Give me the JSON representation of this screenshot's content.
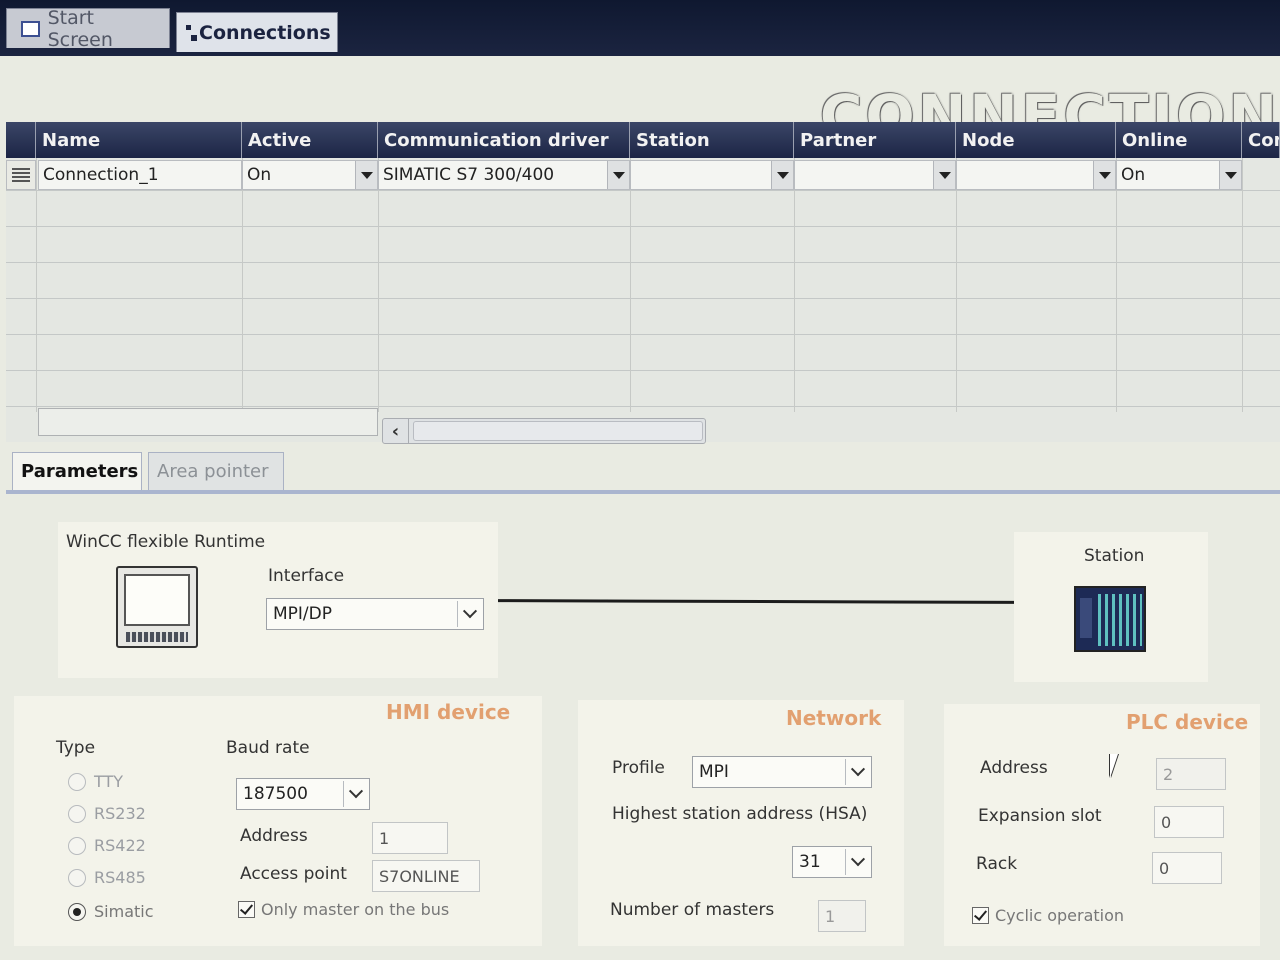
{
  "tabs": [
    {
      "label": "Start Screen",
      "active": false
    },
    {
      "label": "Connections",
      "active": true
    }
  ],
  "page_title": "CONNECTION",
  "table": {
    "columns": [
      "Name",
      "Active",
      "Communication driver",
      "Station",
      "Partner",
      "Node",
      "Online",
      "Con"
    ],
    "rows": [
      {
        "name": "Connection_1",
        "active": "On",
        "driver": "SIMATIC S7 300/400",
        "station": "",
        "partner": "",
        "node": "",
        "online": "On"
      }
    ]
  },
  "subtabs": [
    {
      "label": "Parameters",
      "active": true
    },
    {
      "label": "Area pointer",
      "active": false
    }
  ],
  "diagram": {
    "runtime_label": "WinCC flexible Runtime",
    "interface_label": "Interface",
    "interface_value": "MPI/DP",
    "station_label": "Station"
  },
  "hmi": {
    "title": "HMI device",
    "type_label": "Type",
    "types": [
      "TTY",
      "RS232",
      "RS422",
      "RS485",
      "Simatic"
    ],
    "selected_type": "Simatic",
    "baud_label": "Baud rate",
    "baud_value": "187500",
    "address_label": "Address",
    "address_value": "1",
    "access_label": "Access point",
    "access_value": "S7ONLINE",
    "only_master_label": "Only master on the bus",
    "only_master_checked": true
  },
  "network": {
    "title": "Network",
    "profile_label": "Profile",
    "profile_value": "MPI",
    "hsa_label": "Highest station address (HSA)",
    "hsa_value": "31",
    "masters_label": "Number of masters",
    "masters_value": "1"
  },
  "plc": {
    "title": "PLC device",
    "address_label": "Address",
    "address_value": "2",
    "slot_label": "Expansion slot",
    "slot_value": "0",
    "rack_label": "Rack",
    "rack_value": "0",
    "cyclic_label": "Cyclic operation",
    "cyclic_checked": true
  }
}
